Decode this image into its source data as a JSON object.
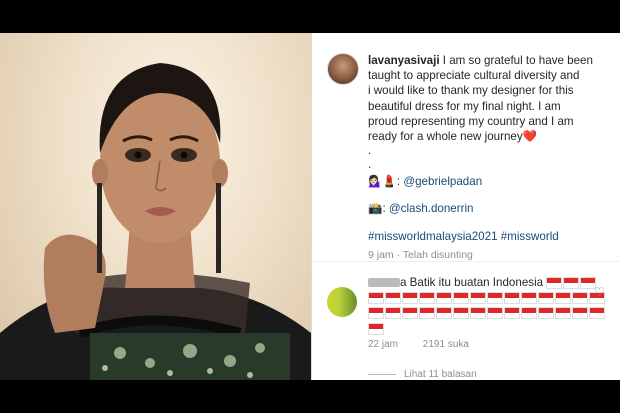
{
  "post": {
    "username": "lavanyasivaji",
    "caption_lines": [
      " I am so grateful to have been",
      "taught to appreciate cultural diversity and",
      "i would like to thank my designer for this",
      "beautiful dress for my final night. I am",
      "proud representing my country and I am",
      "ready for a whole new journey"
    ],
    "heart": "❤️",
    "dot1": ".",
    "dot2": ".",
    "designer_emoji": "💁🏻‍♀️💄",
    "designer_handle": "@gebrielpadan",
    "photographer_emoji": "📸",
    "photographer_handle": "@clash.donerrin",
    "hashtags": "#missworldmalaysia2021 #missworld",
    "time_ago": "9 jam",
    "separator": " · ",
    "edited": "Telah disunting"
  },
  "comment": {
    "text": "a Batik itu buatan Indonesia",
    "flags_line1": 3,
    "flags_line2": 14,
    "flags_line3": 14,
    "flags_line4": 1,
    "time": "22 jam",
    "likes": "2191 suka",
    "view_replies": "Lihat 11 balasan"
  },
  "colors": {
    "link": "#1a4a7a",
    "meta": "#8e8e8e",
    "heart": "#e8393c"
  },
  "icons": {
    "like": "heart-outline-icon"
  }
}
